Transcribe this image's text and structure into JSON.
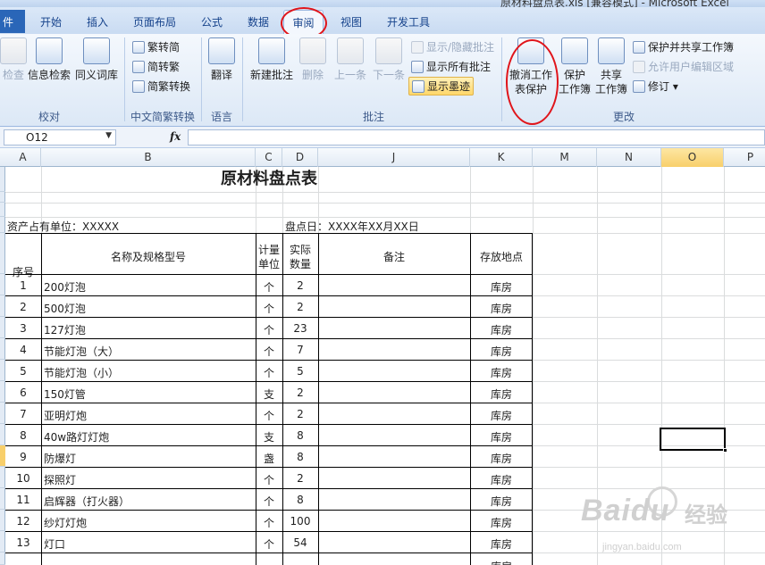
{
  "window": {
    "title": "原材料盘点表.xls [兼容模式] - Microsoft Excel"
  },
  "tabs": [
    "件",
    "开始",
    "插入",
    "页面布局",
    "公式",
    "数据",
    "审阅",
    "视图",
    "开发工具"
  ],
  "active_tab": "审阅",
  "ribbon": {
    "proofing": {
      "spell": "检查",
      "research": "信息检索",
      "thesaurus": "同义词库",
      "label": "校对"
    },
    "chinese": {
      "t2s": "繁转简",
      "s2t": "简转繁",
      "convert": "简繁转换",
      "label": "中文简繁转换"
    },
    "language": {
      "translate": "翻译",
      "label": "语言"
    },
    "comments": {
      "new": "新建批注",
      "delete": "删除",
      "prev": "上一条",
      "next": "下一条",
      "show_hide": "显示/隐藏批注",
      "show_all": "显示所有批注",
      "show_ink": "显示墨迹",
      "label": "批注"
    },
    "changes": {
      "unprotect_line1": "撤消工作",
      "unprotect_line2": "表保护",
      "protect_line1": "保护",
      "protect_line2": "工作簿",
      "share_line1": "共享",
      "share_line2": "工作簿",
      "protect_share": "保护并共享工作簿",
      "allow_edit": "允许用户编辑区域",
      "track": "修订",
      "label": "更改"
    }
  },
  "formula_bar": {
    "name_box": "O12",
    "fx": "fx",
    "content": ""
  },
  "columns": [
    "A",
    "B",
    "C",
    "D",
    "J",
    "K",
    "M",
    "N",
    "O",
    "P"
  ],
  "sheet": {
    "title": "原材料盘点表",
    "unit_label": "资产占有单位：XXXXX",
    "date_label": "盘点日：XXXX年XX月XX日",
    "headers": {
      "no": "序号",
      "name": "名称及规格型号",
      "unit_l1": "计量",
      "unit_l2": "单位",
      "qty_l1": "实际",
      "qty_l2": "数量",
      "note": "备注",
      "loc": "存放地点"
    },
    "rows": [
      {
        "no": "1",
        "name": "200灯泡",
        "unit": "个",
        "qty": "2",
        "loc": "库房"
      },
      {
        "no": "2",
        "name": "500灯泡",
        "unit": "个",
        "qty": "2",
        "loc": "库房"
      },
      {
        "no": "3",
        "name": "127灯泡",
        "unit": "个",
        "qty": "23",
        "loc": "库房"
      },
      {
        "no": "4",
        "name": "节能灯泡（大）",
        "unit": "个",
        "qty": "7",
        "loc": "库房"
      },
      {
        "no": "5",
        "name": "节能灯泡（小）",
        "unit": "个",
        "qty": "5",
        "loc": "库房"
      },
      {
        "no": "6",
        "name": "150灯管",
        "unit": "支",
        "qty": "2",
        "loc": "库房"
      },
      {
        "no": "7",
        "name": "亚明灯炮",
        "unit": "个",
        "qty": "2",
        "loc": "库房"
      },
      {
        "no": "8",
        "name": "40w路灯灯炮",
        "unit": "支",
        "qty": "8",
        "loc": "库房"
      },
      {
        "no": "9",
        "name": "防爆灯",
        "unit": "盏",
        "qty": "8",
        "loc": "库房"
      },
      {
        "no": "10",
        "name": "探照灯",
        "unit": "个",
        "qty": "2",
        "loc": "库房"
      },
      {
        "no": "11",
        "name": "启辉器（打火器）",
        "unit": "个",
        "qty": "8",
        "loc": "库房"
      },
      {
        "no": "12",
        "name": "纱灯灯炮",
        "unit": "个",
        "qty": "100",
        "loc": "库房"
      },
      {
        "no": "13",
        "name": "灯口",
        "unit": "个",
        "qty": "54",
        "loc": "库房"
      }
    ],
    "extra_loc": "库房"
  },
  "watermark": {
    "logo": "Baidu",
    "logo_cn": "经验",
    "sub": "jingyan.baidu.com"
  }
}
